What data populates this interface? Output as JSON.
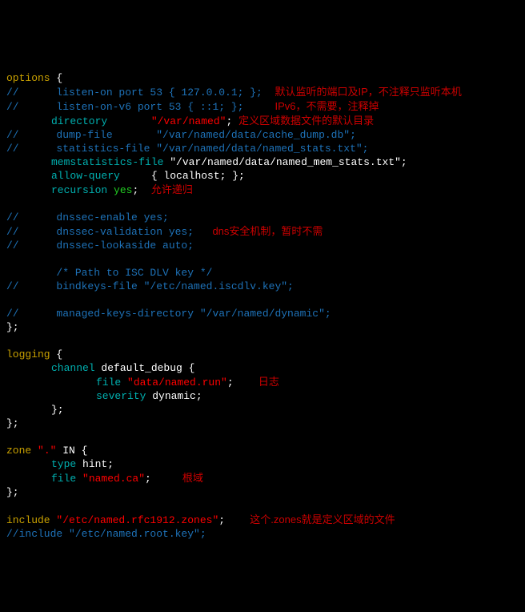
{
  "l1": {
    "kw": "options",
    "b": " {"
  },
  "l2": {
    "c": "//      listen-on port 53 { 127.0.0.1; };",
    "note": "默认监听的端口及IP，不注释只监听本机"
  },
  "l3": {
    "c": "//      listen-on-v6 port 53 { ::1; };",
    "note": "IPv6，不需要，注释掉"
  },
  "l4": {
    "d": "directory",
    "s": "\"/var/named\"",
    "t": ";",
    "note": "定义区域数据文件的默认目录"
  },
  "l5": {
    "c": "//      dump-file       \"/var/named/data/cache_dump.db\";"
  },
  "l6": {
    "c": "//      statistics-file \"/var/named/data/named_stats.txt\";"
  },
  "l7": {
    "d": "memstatistics-file",
    "s": "\"/var/named/data/named_mem_stats.txt\"",
    "t": ";"
  },
  "l8": {
    "d": "allow-query",
    "w": "     { localhost; };"
  },
  "l9": {
    "d": "recursion",
    "g": " yes",
    "w": ";",
    "note": "允许递归"
  },
  "l11": {
    "c": "//      dnssec-enable yes;"
  },
  "l12": {
    "c": "//      dnssec-validation yes;",
    "note": "dns安全机制，暂时不需"
  },
  "l13": {
    "c": "//      dnssec-lookaside auto;"
  },
  "l15": {
    "c": "        /* Path to ISC DLV key */"
  },
  "l16": {
    "c": "//      bindkeys-file \"/etc/named.iscdlv.key\";"
  },
  "l18": {
    "c": "//      managed-keys-directory \"/var/named/dynamic\";"
  },
  "l19": {
    "b": "};"
  },
  "l21": {
    "kw": "logging",
    "b": " {"
  },
  "l22": {
    "d": "channel",
    "w": " default_debug {"
  },
  "l23": {
    "d": "file",
    "s": " \"data/named.run\"",
    "w": ";",
    "note": "日志"
  },
  "l24": {
    "d": "severity",
    "w": " dynamic;"
  },
  "l25": {
    "w": "};"
  },
  "l26": {
    "b": "};"
  },
  "l28": {
    "kw": "zone",
    "s": " \".\"",
    "w": " IN {"
  },
  "l29": {
    "d": "type",
    "w": " hint;"
  },
  "l30": {
    "d": "file",
    "s": " \"named.ca\"",
    "w": ";",
    "note": "根域"
  },
  "l31": {
    "b": "};"
  },
  "l33": {
    "kw": "include",
    "s": " \"/etc/named.rfc1912.zones\"",
    "w": ";",
    "note": "这个.zones就是定义区域的文件"
  },
  "l34": {
    "c": "//include \"/etc/named.root.key\";"
  }
}
